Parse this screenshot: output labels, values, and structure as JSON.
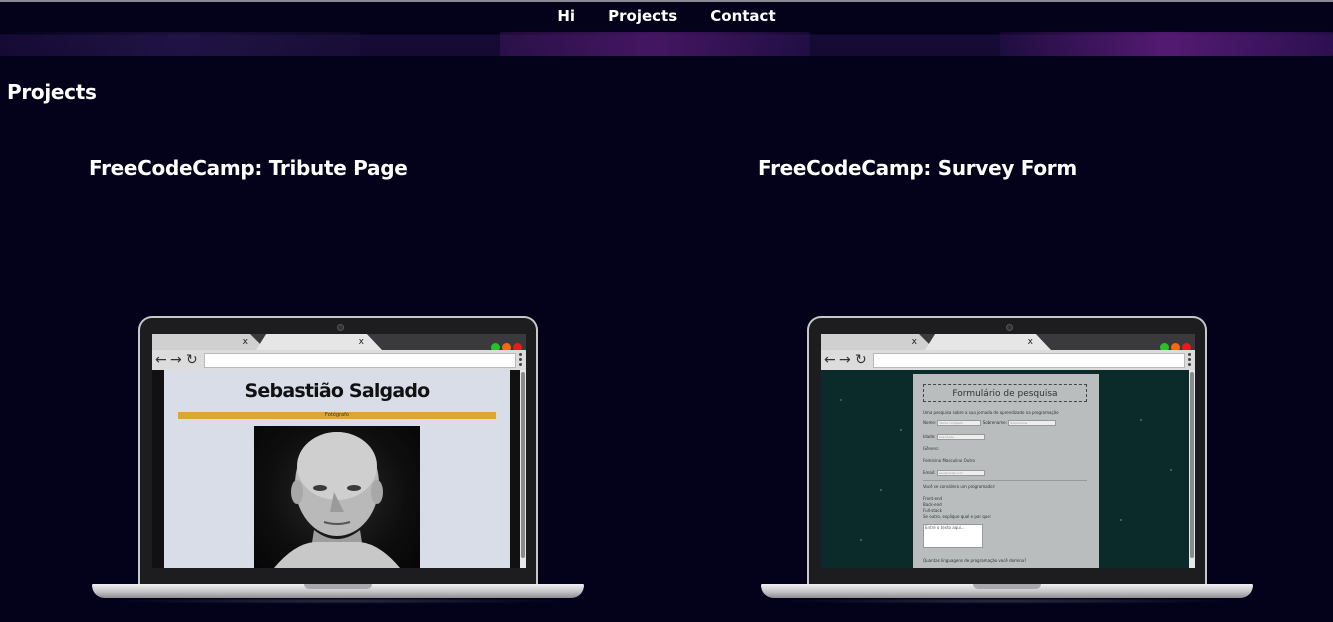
{
  "nav": {
    "links": [
      "Hi",
      "Projects",
      "Contact"
    ]
  },
  "section_title": "Projects",
  "projects": [
    {
      "title": "FreeCodeCamp: Tribute Page",
      "preview": {
        "heading": "Sebastião Salgado",
        "caption": "Fotógrafo"
      }
    },
    {
      "title": "FreeCodeCamp: Survey Form",
      "preview": {
        "heading": "Formulário de pesquisa",
        "subtitle": "Uma pesquisa sobre a sua jornada de aprendizado na programação",
        "name_label": "Nome:",
        "name_placeholder": "Nome completo",
        "surname_label": "Sobrenome:",
        "surname_placeholder": "Sobrenome",
        "age_label": "Idade:",
        "age_placeholder": "Sua Idade",
        "gender_label": "Gênero:",
        "gender_options": "Feminino   Masculino   Outro",
        "email_label": "Email:",
        "email_placeholder": "seu@email.com",
        "dev_question": "Você se considera um programador:",
        "dev_options": [
          "Front-end",
          "Back-end",
          "Full-stack",
          "Se outro, explique qual e por que:"
        ],
        "textarea_placeholder": "Entre o texto aqui...",
        "languages_question": "Quantas linguagens de programação você domina?"
      }
    }
  ],
  "browser": {
    "tab_close": "x",
    "back_icon": "back-arrow-icon",
    "forward_icon": "forward-arrow-icon",
    "reload_icon": "reload-icon"
  },
  "colors": {
    "background": "#03021a",
    "tribute_bar": "#d9a733",
    "survey_bg": "#0b2a2a",
    "dot_green": "#29c12a",
    "dot_orange": "#f06a15",
    "dot_red": "#e81a1a"
  }
}
